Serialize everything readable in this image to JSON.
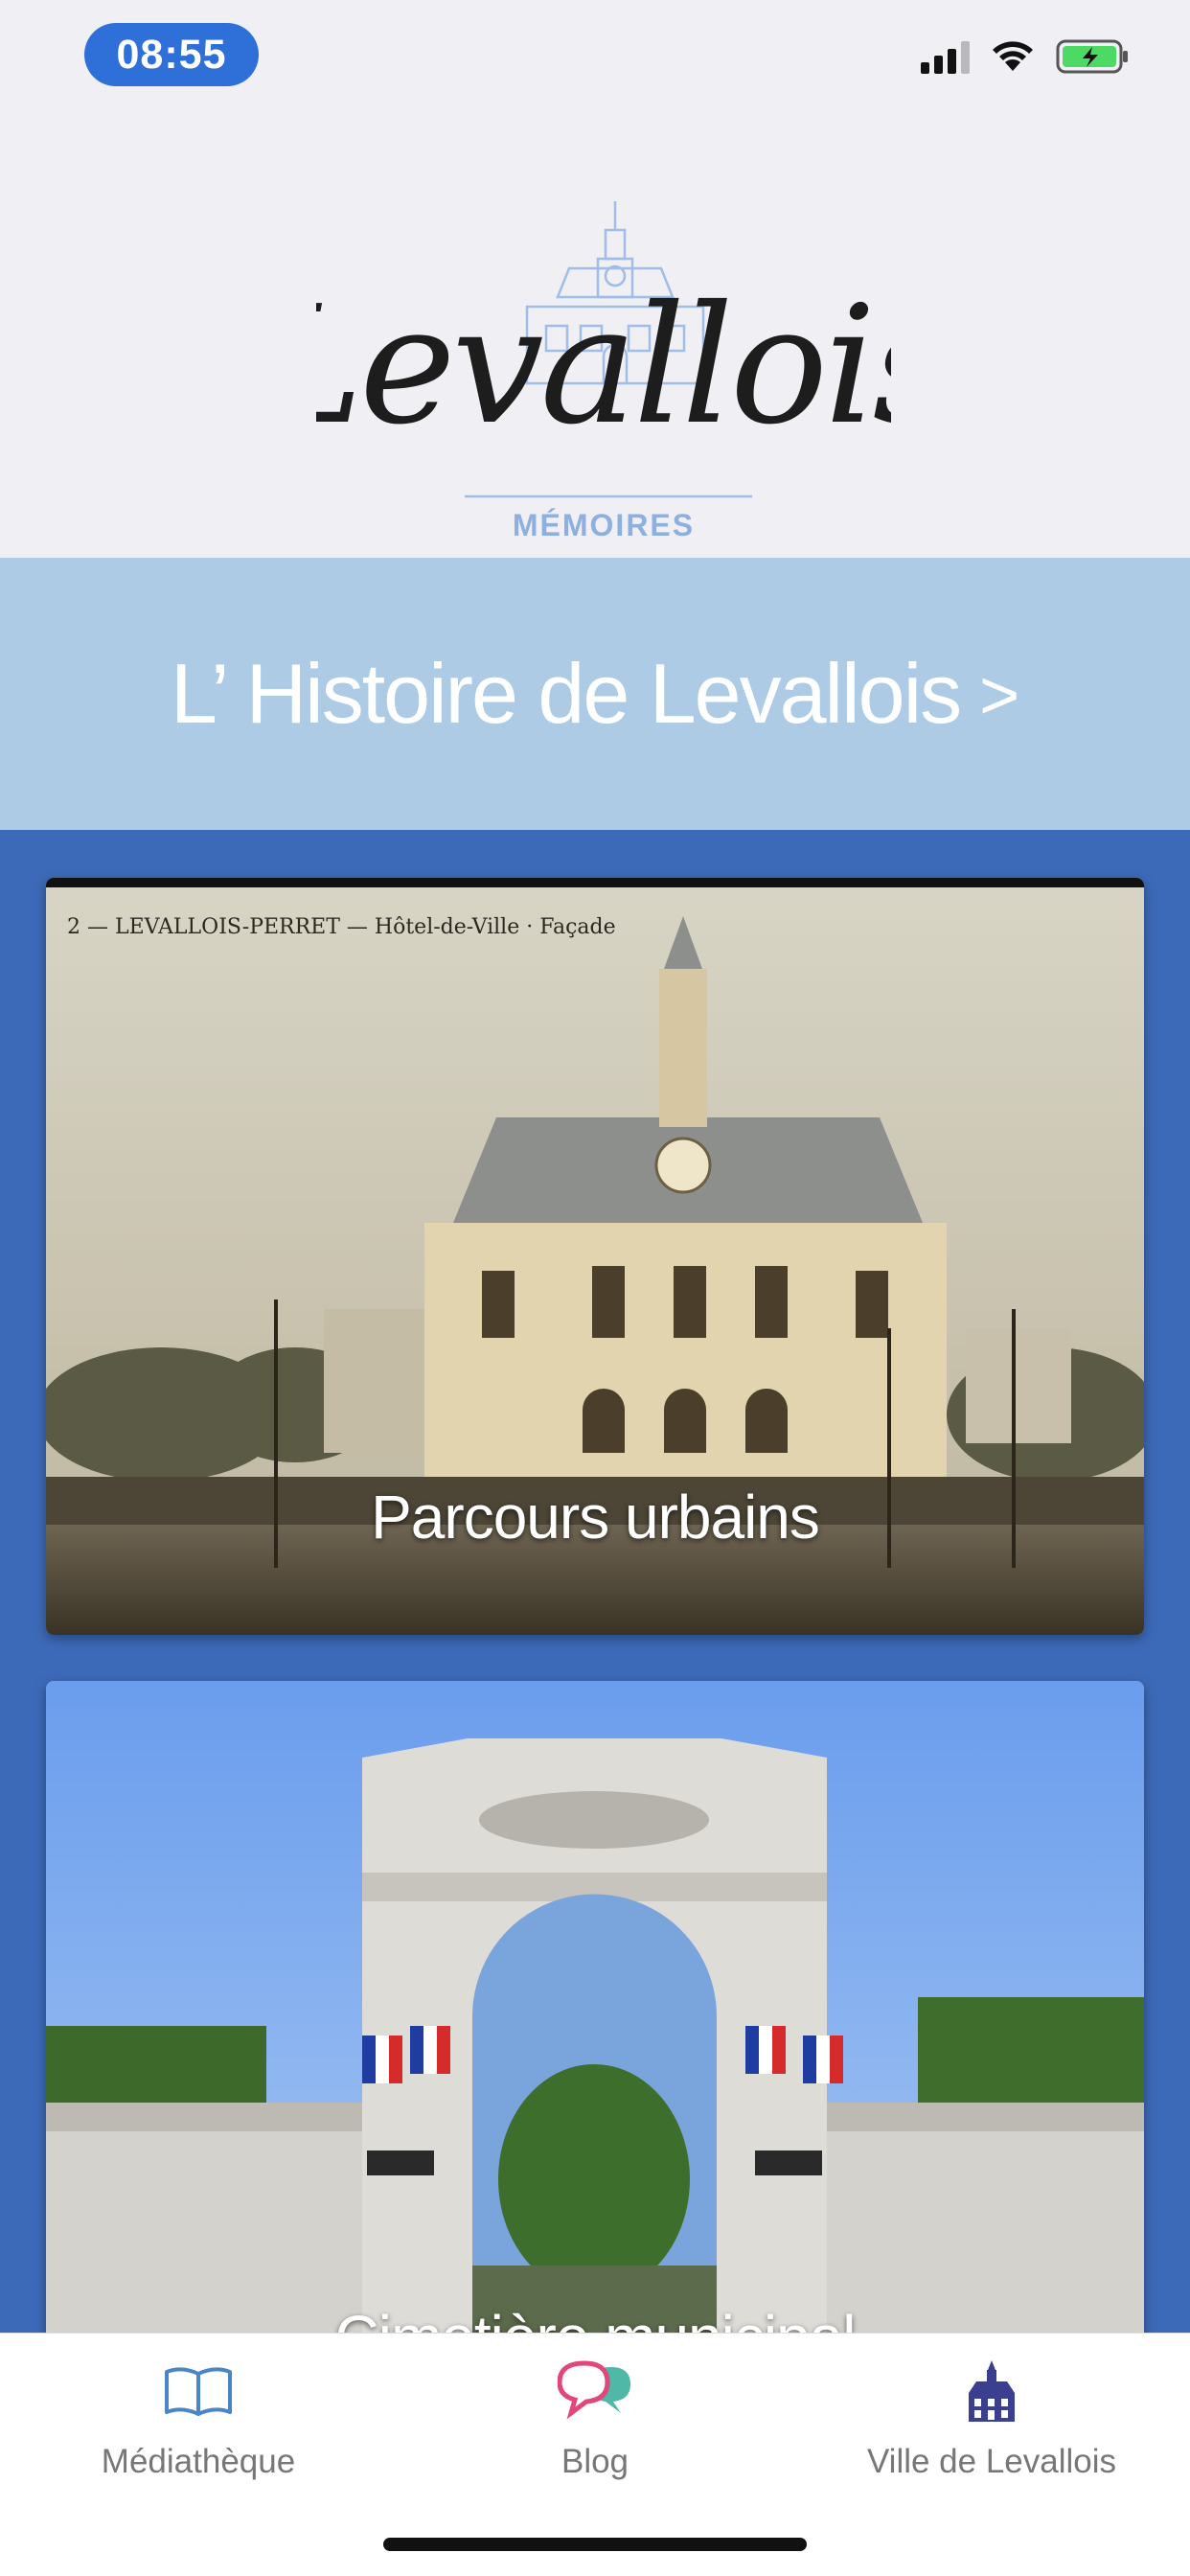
{
  "status_bar": {
    "time": "08:55"
  },
  "header": {
    "logo_script": "Levallois",
    "logo_sub": "MÉMOIRES"
  },
  "history_banner": {
    "label": "L’ Histoire de Levallois",
    "chevron": ">"
  },
  "cards": [
    {
      "title": "Parcours urbains",
      "caption": "2 — LEVALLOIS-PERRET — Hôtel-de-Ville · Façade"
    },
    {
      "title": "Cimetière municipal"
    }
  ],
  "tabbar": {
    "items": [
      {
        "label": "Médiathèque",
        "icon": "book-icon"
      },
      {
        "label": "Blog",
        "icon": "chat-bubbles-icon"
      },
      {
        "label": "Ville de Levallois",
        "icon": "town-hall-icon"
      }
    ]
  },
  "colors": {
    "accent": "#3d6ab8",
    "banner": "#aecbe6",
    "status_pill": "#2e6fd8"
  }
}
